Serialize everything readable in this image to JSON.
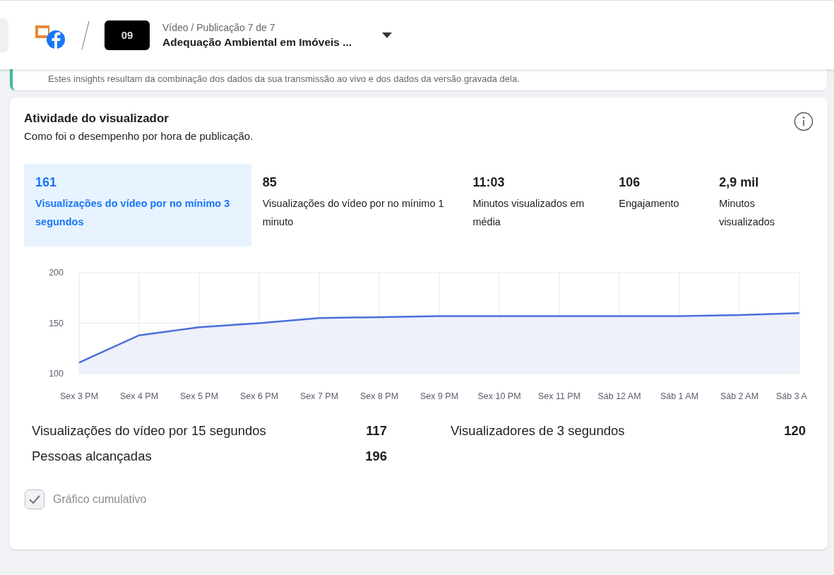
{
  "header": {
    "thumbnail_label": "09",
    "breadcrumb": "Vídeo / Publicação 7 de 7",
    "title": "Adequação Ambiental em Imóveis ..."
  },
  "banner": {
    "text": "Estes insights resultam da combinação dos dados da sua transmissão ao vivo e dos dados da versão gravada dela."
  },
  "card": {
    "title": "Atividade do visualizador",
    "subtitle": "Como foi o desempenho por hora de publicação.",
    "metrics": [
      {
        "value": "161",
        "label": "Visualizações do vídeo por no mínimo 3 segundos",
        "selected": true
      },
      {
        "value": "85",
        "label": "Visualizações do vídeo por no mínimo 1 minuto",
        "selected": false
      },
      {
        "value": "11:03",
        "label": "Minutos visualizados em média",
        "selected": false
      },
      {
        "value": "106",
        "label": "Engajamento",
        "selected": false
      },
      {
        "value": "2,9 mil",
        "label": "Minutos visualizados",
        "selected": false
      }
    ],
    "chart_data": {
      "type": "area",
      "categories": [
        "Sex 3 PM",
        "Sex 4 PM",
        "Sex 5 PM",
        "Sex 6 PM",
        "Sex 7 PM",
        "Sex 8 PM",
        "Sex 9 PM",
        "Sex 10 PM",
        "Sex 11 PM",
        "Sáb 12 AM",
        "Sáb 1 AM",
        "Sáb 2 AM",
        "Sáb 3 A"
      ],
      "grid": true,
      "series": [
        {
          "color": "#4a6fdc",
          "values": [
            111,
            138,
            146,
            150,
            155,
            156,
            157,
            157,
            157,
            157,
            157,
            158,
            160
          ]
        }
      ],
      "ylim": [
        100,
        200
      ],
      "yticks": [
        100,
        150,
        200
      ]
    },
    "stats": [
      {
        "label": "Visualizações do vídeo por 15 segundos",
        "value": "117"
      },
      {
        "label": "Visualizadores de 3 segundos",
        "value": "120"
      },
      {
        "label": "Pessoas alcançadas",
        "value": "196"
      }
    ],
    "cumulative": {
      "label": "Gráfico cumulativo",
      "checked": true,
      "disabled": true
    }
  }
}
